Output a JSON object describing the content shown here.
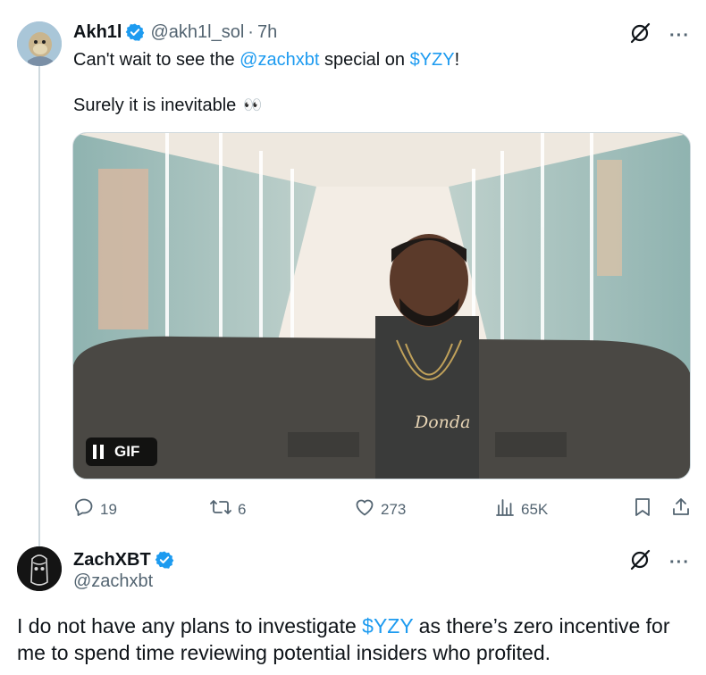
{
  "tweet1": {
    "display_name": "Akh1l",
    "handle": "@akh1l_sol",
    "separator": "·",
    "time": "7h",
    "line1_prefix": "Can't wait to see the ",
    "line1_mention": "@zachxbt",
    "line1_middle": " special on ",
    "line1_cashtag": "$YZY",
    "line1_suffix": "!",
    "line2": "Surely it is inevitable",
    "line2_emoji": "👀",
    "media": {
      "badge_label": "GIF",
      "pendant_text": "Donda"
    },
    "actions": {
      "replies": "19",
      "reposts": "6",
      "likes": "273",
      "views": "65K"
    },
    "more_label": "···"
  },
  "tweet2": {
    "display_name": "ZachXBT",
    "handle": "@zachxbt",
    "text_prefix": "I do not have any plans to investigate ",
    "text_cashtag": "$YZY",
    "text_suffix": " as there’s zero incentive for me to spend time reviewing potential insiders who profited.",
    "more_label": "···"
  },
  "colors": {
    "link": "#1d9bf0",
    "muted": "#536471",
    "text": "#0f1419",
    "thread_line": "#cfd9de"
  },
  "icons": [
    "verified-badge-icon",
    "grok-slash-icon",
    "more-icon",
    "reply-icon",
    "repost-icon",
    "like-icon",
    "views-icon",
    "bookmark-icon",
    "share-icon",
    "pause-icon"
  ]
}
